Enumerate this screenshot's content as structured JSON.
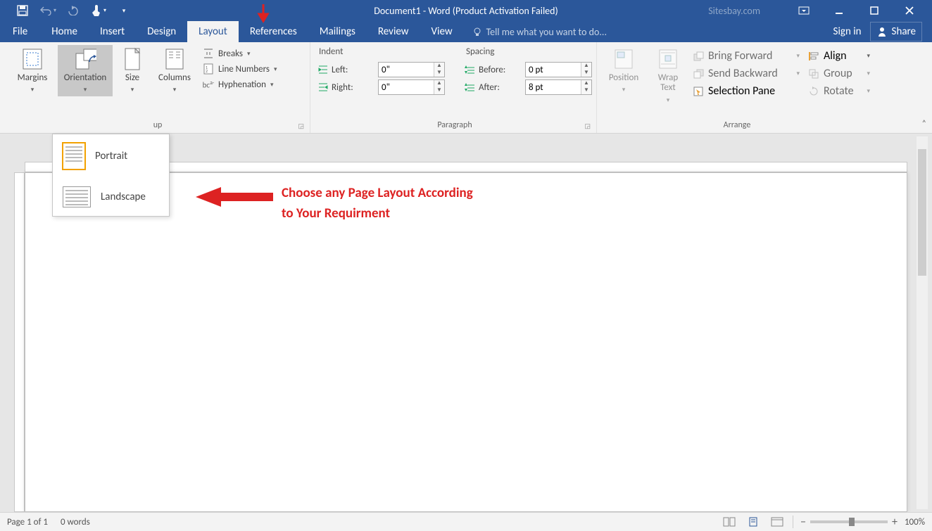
{
  "title": "Document1 - Word (Product Activation Failed)",
  "watermark": "Sitesbay.com",
  "tabs": {
    "file": "File",
    "home": "Home",
    "insert": "Insert",
    "design": "Design",
    "layout": "Layout",
    "references": "References",
    "mailings": "Mailings",
    "review": "Review",
    "view": "View",
    "tellme": "Tell me what you want to do..."
  },
  "signin": "Sign in",
  "share": "Share",
  "ribbon": {
    "page_setup": {
      "margins": "Margins",
      "orientation": "Orientation",
      "size": "Size",
      "columns": "Columns",
      "breaks": "Breaks",
      "line_numbers": "Line Numbers",
      "hyphenation": "Hyphenation",
      "group_label": "up"
    },
    "paragraph": {
      "indent_title": "Indent",
      "spacing_title": "Spacing",
      "left_label": "Left:",
      "right_label": "Right:",
      "before_label": "Before:",
      "after_label": "After:",
      "left_val": "0\"",
      "right_val": "0\"",
      "before_val": "0 pt",
      "after_val": "8 pt",
      "group_label": "Paragraph"
    },
    "arrange": {
      "position": "Position",
      "wrap_text": "Wrap\nText",
      "bring_forward": "Bring Forward",
      "send_backward": "Send Backward",
      "selection_pane": "Selection Pane",
      "align": "Align",
      "group": "Group",
      "rotate": "Rotate",
      "group_label": "Arrange"
    }
  },
  "orientation_menu": {
    "portrait": "Portrait",
    "landscape": "Landscape"
  },
  "annotation": {
    "line1": "Choose any Page Layout According",
    "line2": "to Your Requirment"
  },
  "status": {
    "page": "Page 1 of 1",
    "words": "0 words",
    "zoom": "100%"
  }
}
